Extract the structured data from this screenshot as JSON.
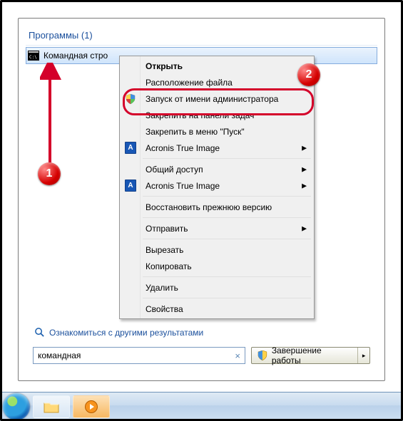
{
  "heading": {
    "label": "Программы",
    "count": "(1)"
  },
  "resultItem": {
    "label": "Командная стро"
  },
  "contextMenu": {
    "open": "Открыть",
    "fileLocation": "Расположение файла",
    "runAsAdmin": "Запуск от имени администратора",
    "pinTaskbar": "Закрепить на панели задач",
    "pinStart": "Закрепить в меню \"Пуск\"",
    "acronis1": "Acronis True Image",
    "sharing": "Общий доступ",
    "acronis2": "Acronis True Image",
    "restorePrev": "Восстановить прежнюю версию",
    "sendTo": "Отправить",
    "cut": "Вырезать",
    "copy": "Копировать",
    "del": "Удалить",
    "props": "Свойства",
    "acronisLetter": "A"
  },
  "moreResults": "Ознакомиться с другими результатами",
  "search": {
    "value": "командная"
  },
  "shutdown": {
    "label": "Завершение работы"
  },
  "annotations": {
    "b1": "1",
    "b2": "2"
  }
}
